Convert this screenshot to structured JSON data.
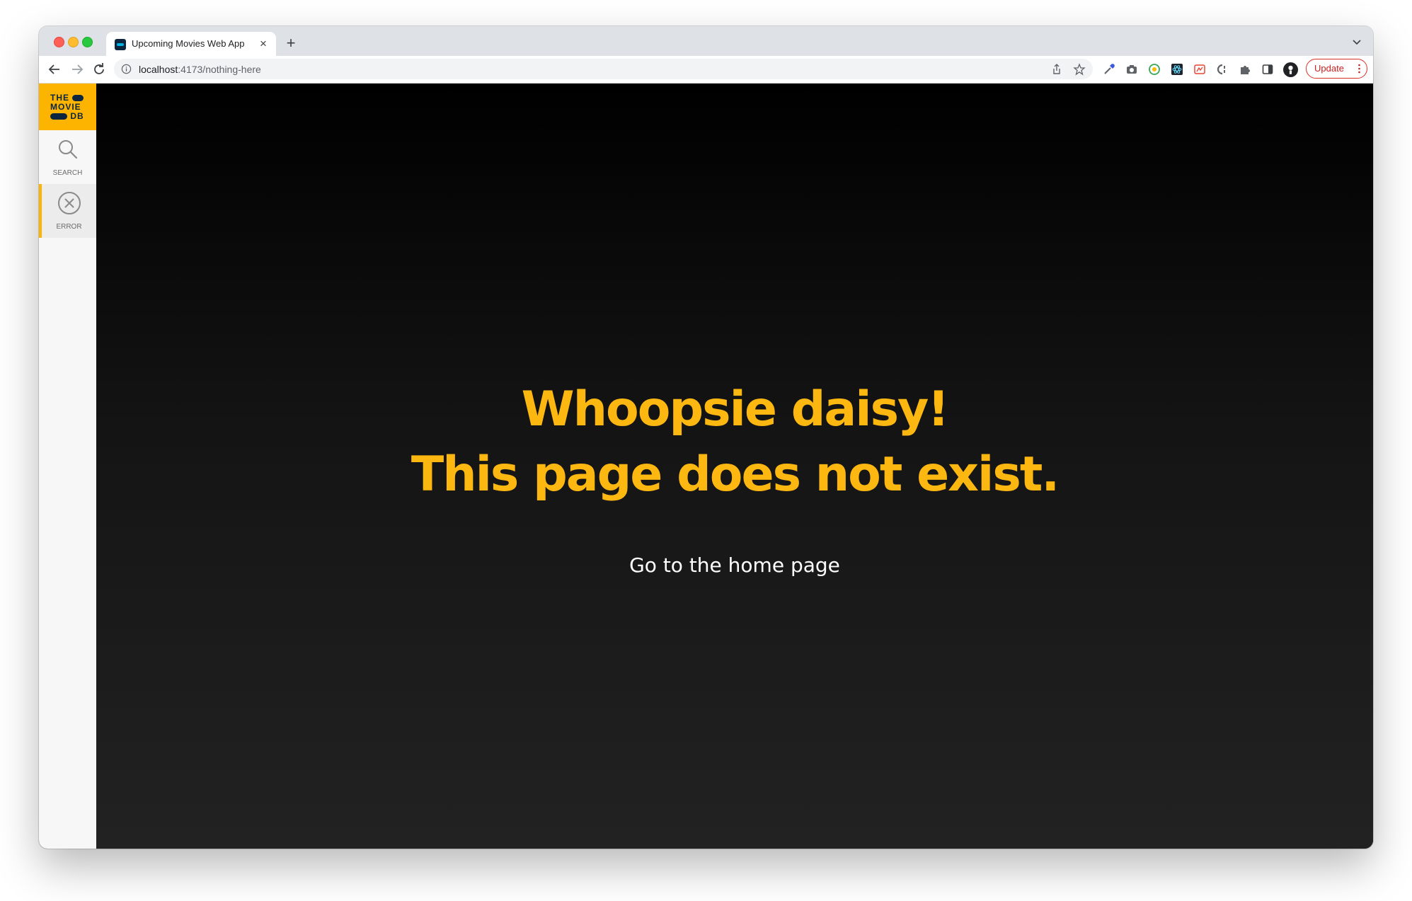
{
  "browser": {
    "tab": {
      "title": "Upcoming Movies Web App",
      "close_icon": "close-icon"
    },
    "new_tab_label": "+",
    "url": {
      "host": "localhost",
      "path": ":4173/nothing-here"
    },
    "update_label": "Update"
  },
  "sidebar": {
    "logo": {
      "line1": "THE",
      "line2": "MOVIE",
      "line3": "DB"
    },
    "items": [
      {
        "label": "SEARCH",
        "icon": "search-icon",
        "active": false
      },
      {
        "label": "ERROR",
        "icon": "close-circle-icon",
        "active": true
      }
    ]
  },
  "main": {
    "headline_line1": "Whoopsie daisy!",
    "headline_line2": "This page does not exist.",
    "home_link": "Go to the home page"
  },
  "colors": {
    "accent": "#fcb711",
    "logo_bg": "#fcb400",
    "update": "#c5221f"
  }
}
